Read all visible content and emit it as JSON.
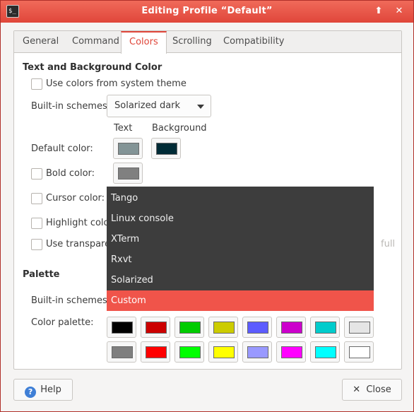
{
  "window": {
    "title": "Editing Profile “Default”",
    "icon_glyph": "$_",
    "keep_above_glyph": "⬆",
    "close_glyph": "✕"
  },
  "tabs": [
    {
      "label": "General"
    },
    {
      "label": "Command"
    },
    {
      "label": "Colors"
    },
    {
      "label": "Scrolling"
    },
    {
      "label": "Compatibility"
    }
  ],
  "text_bg": {
    "section_title": "Text and Background Color",
    "use_system_theme": "Use colors from system theme",
    "builtin_schemes_label": "Built-in schemes:",
    "builtin_scheme_value": "Solarized dark",
    "col_text": "Text",
    "col_background": "Background",
    "default_color_label": "Default color:",
    "bold_color_label": "Bold color:",
    "cursor_color_label": "Cursor color:",
    "highlight_color_label": "Highlight color:",
    "use_transparent_label": "Use transparen",
    "transparency_end_label": "full"
  },
  "colors": {
    "default_text": "#839496",
    "default_background": "#002b36",
    "bold_text": "#808080"
  },
  "dropdown": {
    "items": [
      {
        "label": "Tango"
      },
      {
        "label": "Linux console"
      },
      {
        "label": "XTerm"
      },
      {
        "label": "Rxvt"
      },
      {
        "label": "Solarized"
      },
      {
        "label": "Custom"
      }
    ],
    "selected": "Custom"
  },
  "palette": {
    "section_title": "Palette",
    "builtin_schemes_label": "Built-in schemes:",
    "color_palette_label": "Color palette:",
    "row1": [
      "#000000",
      "#cc0000",
      "#00cc00",
      "#cccc00",
      "#5c5cff",
      "#cc00cc",
      "#00cccc",
      "#e5e5e5"
    ],
    "row2": [
      "#7f7f7f",
      "#ff0000",
      "#00ff00",
      "#ffff00",
      "#9999ff",
      "#ff00ff",
      "#00ffff",
      "#ffffff"
    ]
  },
  "buttons": {
    "help_icon": "?",
    "help": "Help",
    "close_icon": "✕",
    "close": "Close"
  }
}
